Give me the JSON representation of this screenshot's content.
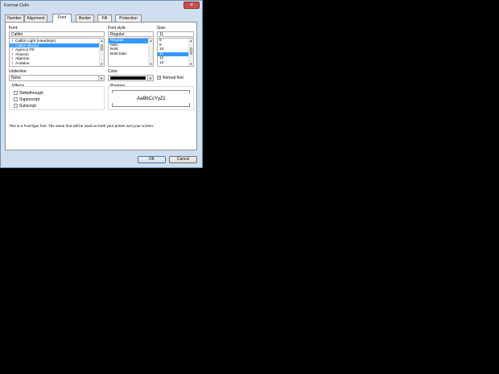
{
  "window": {
    "title": "Format Cells",
    "close_glyph": "×"
  },
  "tabs": [
    {
      "label": "Number",
      "active": false
    },
    {
      "label": "Alignment",
      "active": false
    },
    {
      "label": "Font",
      "active": true
    },
    {
      "label": "Border",
      "active": false
    },
    {
      "label": "Fill",
      "active": false
    },
    {
      "label": "Protection",
      "active": false
    }
  ],
  "font": {
    "label": "Font:",
    "value": "Calibri",
    "items": [
      {
        "label": "Calibri Light (Headings)",
        "selected": false
      },
      {
        "label": "Calibri (Body)",
        "selected": true
      },
      {
        "label": "Agency FB",
        "selected": false
      },
      {
        "label": "Aharoni",
        "selected": false
      },
      {
        "label": "Algerian",
        "selected": false
      },
      {
        "label": "Andalus",
        "selected": false
      }
    ]
  },
  "font_style": {
    "label": "Font style:",
    "value": "Regular",
    "items": [
      {
        "label": "Regular",
        "selected": true
      },
      {
        "label": "Italic",
        "selected": false
      },
      {
        "label": "Bold",
        "selected": false
      },
      {
        "label": "Bold Italic",
        "selected": false
      }
    ]
  },
  "size": {
    "label": "Size:",
    "value": "11",
    "items": [
      {
        "label": "8",
        "selected": false
      },
      {
        "label": "9",
        "selected": false
      },
      {
        "label": "10",
        "selected": false
      },
      {
        "label": "11",
        "selected": true
      },
      {
        "label": "12",
        "selected": false
      },
      {
        "label": "14",
        "selected": false
      }
    ]
  },
  "underline": {
    "label": "Underline:",
    "value": "None"
  },
  "color": {
    "label": "Color:",
    "swatch": "#000000"
  },
  "normal_font": {
    "label": "Normal font",
    "checked": true
  },
  "effects": {
    "label": "Effects",
    "items": [
      {
        "label": "Strikethrough",
        "checked": false
      },
      {
        "label": "Superscript",
        "checked": false
      },
      {
        "label": "Subscript",
        "checked": false
      }
    ]
  },
  "preview": {
    "label": "Preview",
    "sample": "AaBbCcYyZz"
  },
  "info_text": "This is a TrueType font.  The same font will be used on both your printer and your screen.",
  "buttons": {
    "ok": "OK",
    "cancel": "Cancel"
  },
  "icons": {
    "font_type": "truetype-font-icon",
    "dropdown": "chevron-down-icon",
    "scroll_up": "scroll-up-icon",
    "scroll_down": "scroll-down-icon"
  },
  "colors": {
    "selection": "#3399ff",
    "dialog_bg": "#cfdff0",
    "close_button": "#c75050"
  }
}
